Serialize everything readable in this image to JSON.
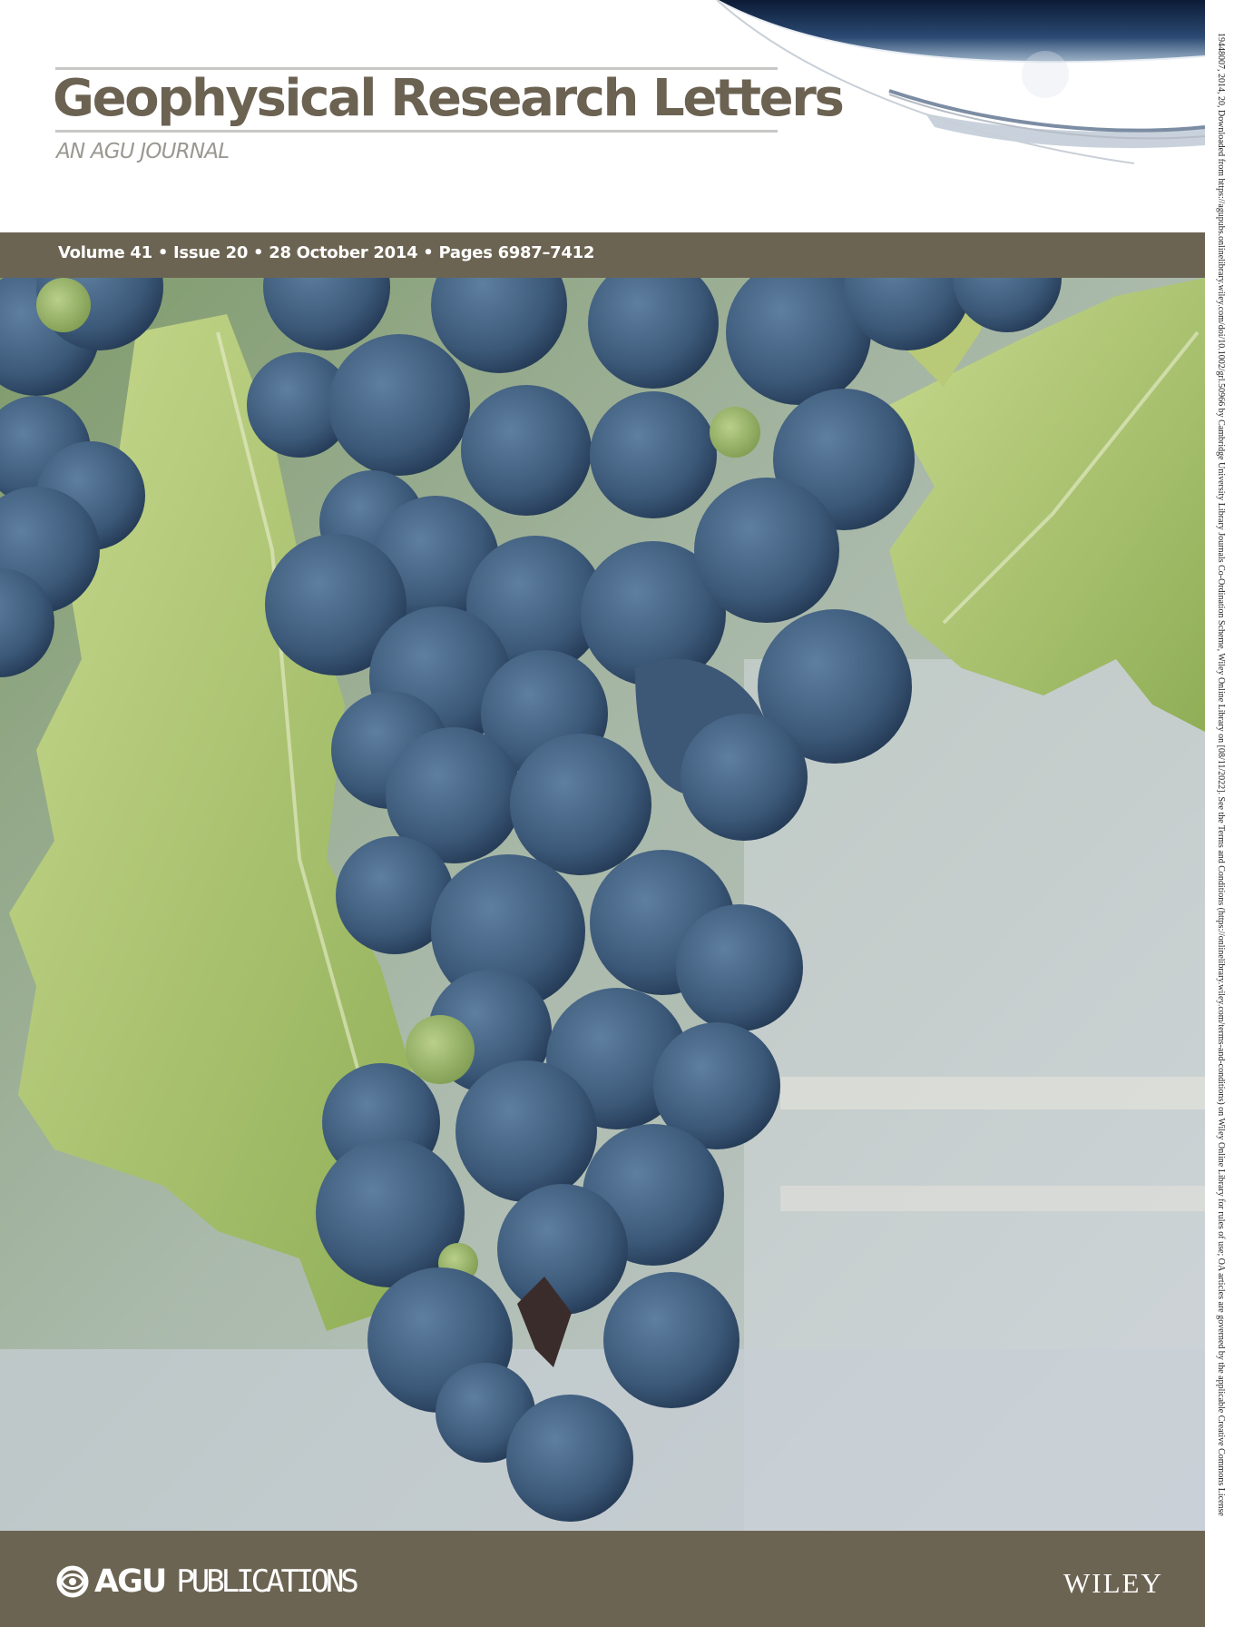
{
  "masthead": {
    "journal_title": "Geophysical Research Letters",
    "journal_subtitle": "AN AGU JOURNAL"
  },
  "issue_bar": {
    "text": "Volume 41 • Issue 20 • 28 October 2014 • Pages 6987–7412"
  },
  "footer": {
    "publisher_logo_letters": "AGU",
    "publisher_logo_word": "PUBLICATIONS",
    "wiley_logo": "WILEY"
  },
  "side_note": {
    "text": "19448007, 2014, 20, Downloaded from https://agupubs.onlinelibrary.wiley.com/doi/10.1002/grl.50966 by Cambridge University Library Journals Co-Ordination Scheme, Wiley Online Library on [08/11/2022]. See the Terms and Conditions (https://onlinelibrary.wiley.com/terms-and-conditions) on Wiley Online Library for rules of use; OA articles are governed by the applicable Creative Commons License"
  },
  "colors": {
    "bar_brown": "#6c6453",
    "title_brown": "#6b6252",
    "grape_blue": "#3f5d7c",
    "leaf_green": "#a9bf6a"
  }
}
